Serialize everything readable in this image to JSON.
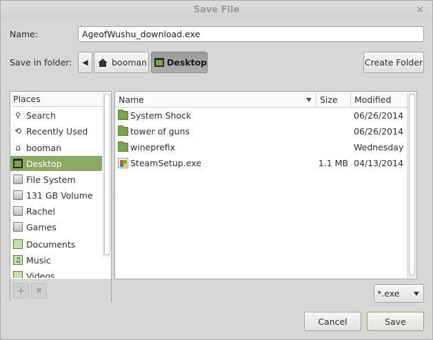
{
  "window": {
    "title": "Save File",
    "close_glyph": "×"
  },
  "form": {
    "name_label": "Name:",
    "name_value": "AgeofWushu_download.exe",
    "folder_label": "Save in folder:"
  },
  "path_bar": {
    "back_glyph": "◀",
    "items": [
      {
        "label": "booman",
        "icon": "home-icon"
      },
      {
        "label": "Desktop",
        "icon": "desktop-icon",
        "active": true
      }
    ]
  },
  "create_folder_label": "Create Folder",
  "places": {
    "header": "Places",
    "items": [
      {
        "label": "Search",
        "icon": "search-icon",
        "glyph": "🔍"
      },
      {
        "label": "Recently Used",
        "icon": "recent-icon",
        "glyph": "⟲"
      },
      {
        "label": "booman",
        "icon": "home-icon",
        "glyph": "⌂"
      },
      {
        "label": "Desktop",
        "icon": "desktop-icon",
        "selected": true
      },
      {
        "label": "File System",
        "icon": "drive-icon"
      },
      {
        "label": "131 GB Volume",
        "icon": "drive-icon"
      },
      {
        "label": "Rachel",
        "icon": "drive-icon"
      },
      {
        "label": "Games",
        "icon": "drive-icon"
      },
      {
        "label": "Documents",
        "icon": "documents-folder-icon"
      },
      {
        "label": "Music",
        "icon": "music-folder-icon",
        "glyph": "♫"
      },
      {
        "label": "Videos",
        "icon": "videos-folder-icon"
      }
    ],
    "add_glyph": "+",
    "remove_glyph": "✖"
  },
  "files": {
    "columns": {
      "name": "Name",
      "size": "Size",
      "modified": "Modified"
    },
    "rows": [
      {
        "name": "System Shock",
        "size": "",
        "modified": "06/26/2014",
        "type": "folder"
      },
      {
        "name": "tower of guns",
        "size": "",
        "modified": "06/26/2014",
        "type": "folder"
      },
      {
        "name": "wineprefix",
        "size": "",
        "modified": "Wednesday",
        "type": "folder"
      },
      {
        "name": "SteamSetup.exe",
        "size": "1.1 MB",
        "modified": "04/13/2014",
        "type": "exe"
      }
    ]
  },
  "filter": {
    "value": "*.exe"
  },
  "buttons": {
    "cancel": "Cancel",
    "save": "Save"
  },
  "colors": {
    "accent": "#8ba864",
    "folder": "#7fa152"
  }
}
